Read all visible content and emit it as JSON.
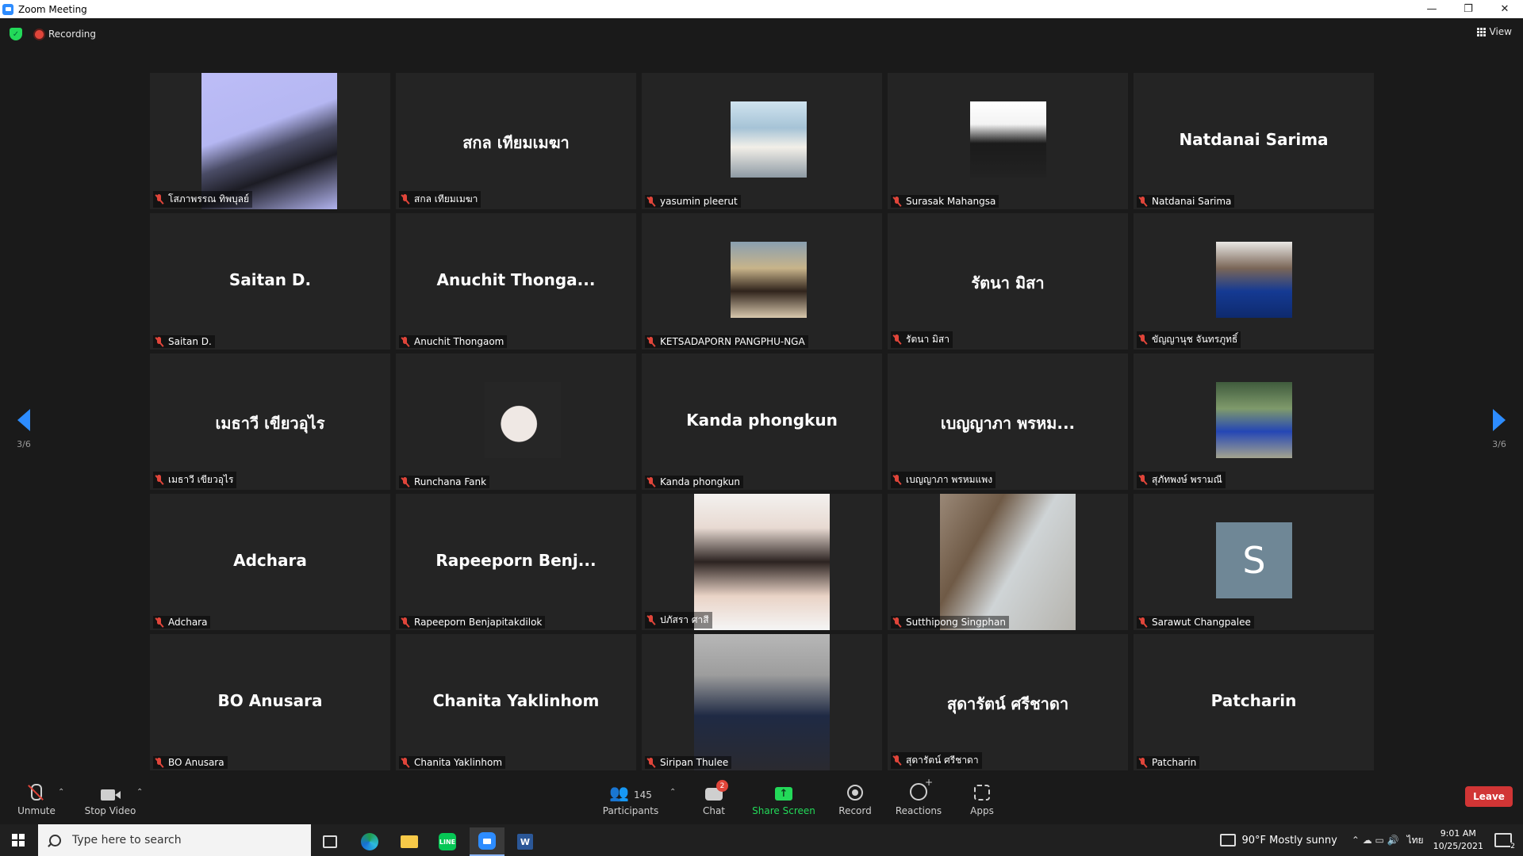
{
  "window": {
    "title": "Zoom Meeting",
    "controls": [
      "—",
      "❐",
      "✕"
    ]
  },
  "topbar": {
    "recording_label": "Recording",
    "view_label": "View"
  },
  "pagination": {
    "current": "3/6"
  },
  "participants": [
    {
      "display": "photo",
      "label": "โสภาพรรณ ทิพบุลย์"
    },
    {
      "display": "name",
      "big_name": "สกล เทียมเมฆา",
      "label": "สกล เทียมเมฆา"
    },
    {
      "display": "thumb",
      "label": "yasumin pleerut"
    },
    {
      "display": "thumb",
      "label": "Surasak Mahangsa"
    },
    {
      "display": "name",
      "big_name": "Natdanai Sarima",
      "label": "Natdanai Sarima"
    },
    {
      "display": "name",
      "big_name": "Saitan D.",
      "label": "Saitan D."
    },
    {
      "display": "name",
      "big_name": "Anuchit  Thonga...",
      "label": "Anuchit Thongaom"
    },
    {
      "display": "thumb",
      "label": "KETSADAPORN PANGPHU-NGA"
    },
    {
      "display": "name",
      "big_name": "รัตนา มิสา",
      "label": "รัตนา มิสา"
    },
    {
      "display": "thumb",
      "label": "ขัญญานุช จันทรภูทธิ์"
    },
    {
      "display": "name",
      "big_name": "เมธาวี เขียวอุไร",
      "label": "เมธาวี เขียวอุไร"
    },
    {
      "display": "thumb",
      "label": "Runchana Fank"
    },
    {
      "display": "name",
      "big_name": "Kanda phongkun",
      "label": "Kanda phongkun"
    },
    {
      "display": "name",
      "big_name": "เบญญาภา พรหม...",
      "label": "เบญญาภา พรหมแพง"
    },
    {
      "display": "thumb",
      "label": "สุภัทพงษ์ พรามณี"
    },
    {
      "display": "name",
      "big_name": "Adchara",
      "label": "Adchara"
    },
    {
      "display": "name",
      "big_name": "Rapeeporn  Benj...",
      "label": "Rapeeporn Benjapitakdilok"
    },
    {
      "display": "photo",
      "label": "ปภัสรา ศาสี"
    },
    {
      "display": "photo",
      "label": "Sutthipong Singphan"
    },
    {
      "display": "avatar",
      "avatar_letter": "S",
      "label": "Sarawut Changpalee"
    },
    {
      "display": "name",
      "big_name": "BO Anusara",
      "label": "BO Anusara"
    },
    {
      "display": "name",
      "big_name": "Chanita Yaklinhom",
      "label": "Chanita Yaklinhom"
    },
    {
      "display": "photo",
      "label": "Siripan Thulee"
    },
    {
      "display": "name",
      "big_name": "สุดารัตน์ ศรีชาดา",
      "label": "สุดารัตน์ ศรีชาดา"
    },
    {
      "display": "name",
      "big_name": "Patcharin",
      "label": "Patcharin"
    }
  ],
  "toolbar": {
    "unmute": "Unmute",
    "stop_video": "Stop Video",
    "participants": "Participants",
    "participant_count": "145",
    "chat": "Chat",
    "chat_badge": "2",
    "share_screen": "Share Screen",
    "record": "Record",
    "reactions": "Reactions",
    "apps": "Apps",
    "leave": "Leave",
    "caret": "⌃"
  },
  "taskbar": {
    "search_placeholder": "Type here to search",
    "line_label": "LINE",
    "word_label": "W",
    "weather": "90°F  Mostly sunny",
    "tray_icons": "⌃  ☁  ▭  🔊",
    "language": "ไทย",
    "time": "9:01 AM",
    "date": "10/25/2021",
    "notifications": "2"
  },
  "colors": {
    "accent": "#2d8cff",
    "share_green": "#23d959",
    "leave_red": "#d13535",
    "muted_red": "#e0453a"
  }
}
